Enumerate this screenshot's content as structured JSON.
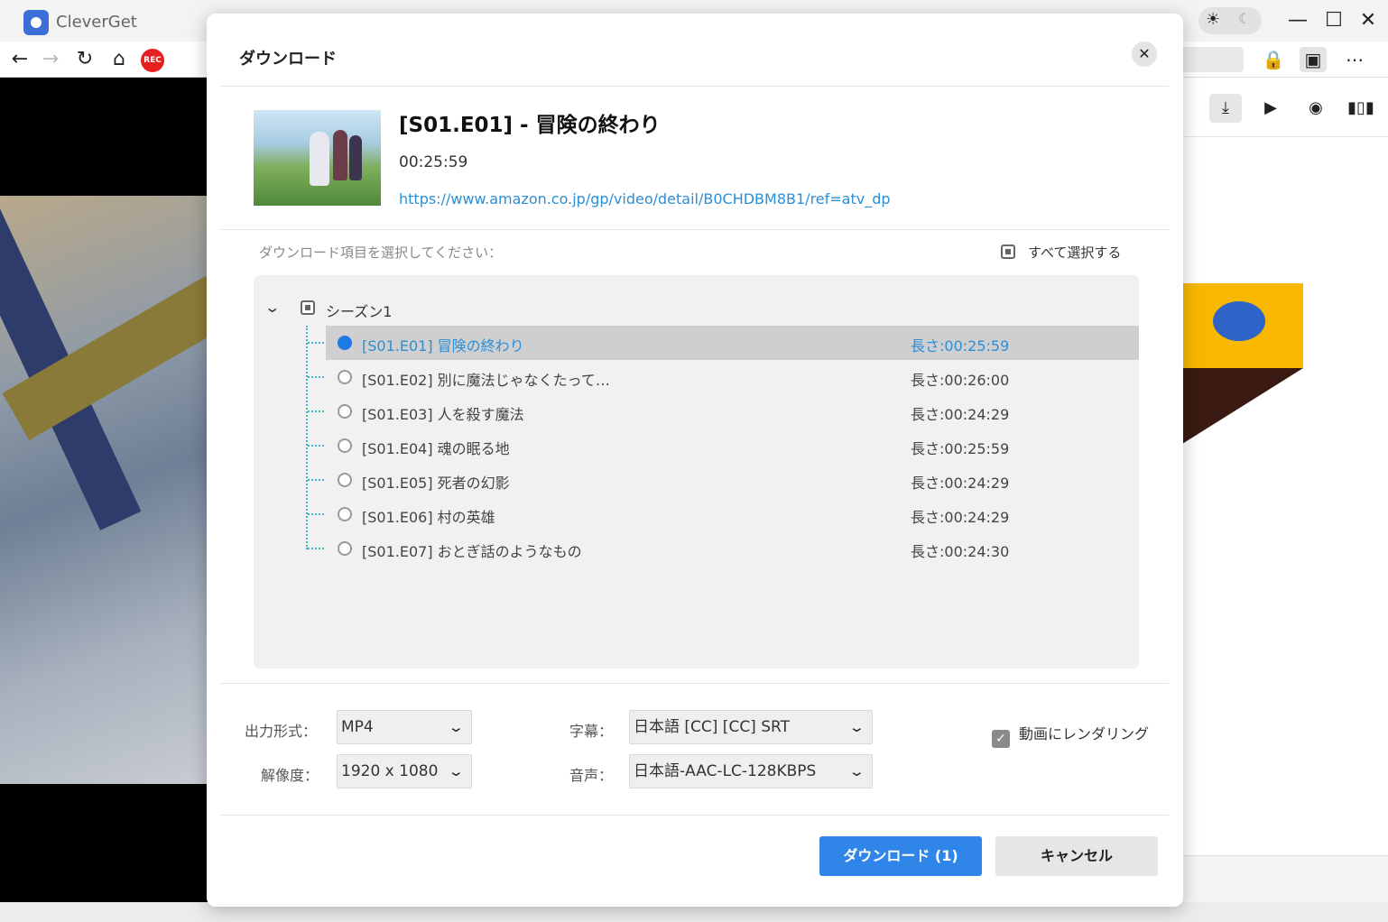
{
  "app": {
    "title": "CleverGet"
  },
  "window": {
    "minimize_icon": "minimize-icon",
    "maximize_icon": "maximize-icon",
    "close_icon": "close-icon"
  },
  "nav": {
    "rec_label": "REC"
  },
  "dialog": {
    "title": "ダウンロード",
    "close_icon": "close-icon",
    "video": {
      "title": "[S01.E01] - 冒険の終わり",
      "duration": "00:25:59",
      "url": "https://www.amazon.co.jp/gp/video/detail/B0CHDBM8B1/ref=atv_dp"
    },
    "select_prompt": "ダウンロード項目を選択してください：",
    "select_all_label": "すべて選択する",
    "season_label": "シーズン1",
    "episodes": [
      {
        "name": "[S01.E01] 冒険の終わり",
        "length": "長さ:00:25:59",
        "selected": true
      },
      {
        "name": "[S01.E02] 別に魔法じゃなくたって…",
        "length": "長さ:00:26:00",
        "selected": false
      },
      {
        "name": "[S01.E03] 人を殺す魔法",
        "length": "長さ:00:24:29",
        "selected": false
      },
      {
        "name": "[S01.E04] 魂の眠る地",
        "length": "長さ:00:25:59",
        "selected": false
      },
      {
        "name": "[S01.E05] 死者の幻影",
        "length": "長さ:00:24:29",
        "selected": false
      },
      {
        "name": "[S01.E06] 村の英雄",
        "length": "長さ:00:24:29",
        "selected": false
      },
      {
        "name": "[S01.E07] おとぎ話のようなもの",
        "length": "長さ:00:24:30",
        "selected": false
      }
    ],
    "options": {
      "format_label": "出力形式：",
      "format_value": "MP4",
      "resolution_label": "解像度：",
      "resolution_value": "1920 x 1080",
      "subtitle_label": "字幕：",
      "subtitle_value": "日本語 [CC] [CC] SRT",
      "audio_label": "音声：",
      "audio_value": "日本語-AAC-LC-128KBPS",
      "render_label": "動画にレンダリング",
      "render_checked": true
    },
    "download_button": "ダウンロード (1)",
    "cancel_button": "キャンセル"
  },
  "colors": {
    "accent": "#2f86e8",
    "link": "#2b8fd6",
    "selected_row": "#cfcfcf",
    "tree_line": "#43b5c8"
  }
}
